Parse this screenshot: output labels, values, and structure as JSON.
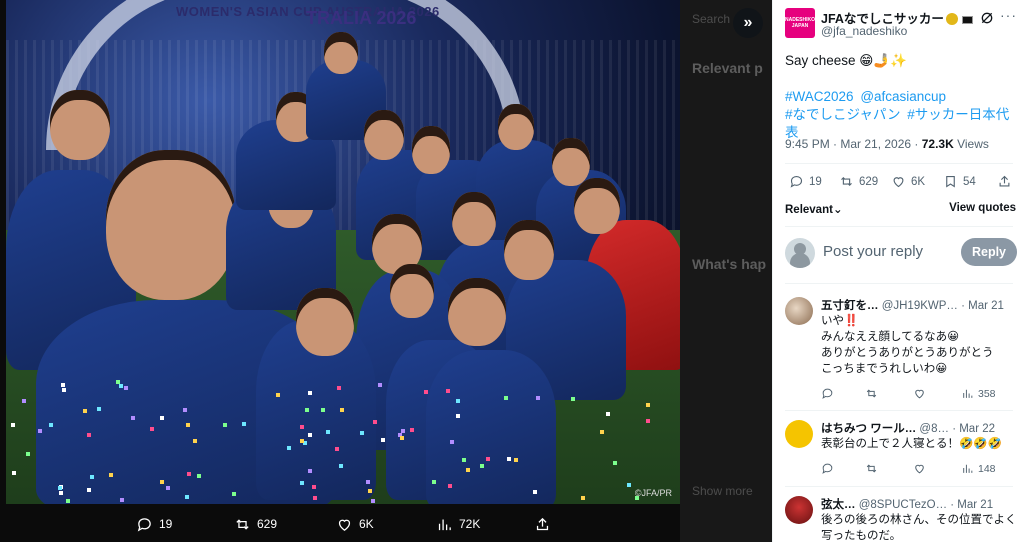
{
  "viewer": {
    "photo_alt": "",
    "arch_text_small": "WOMEN'S ASIAN CUP AUSTRALIA 2026",
    "arch_text_large": "TRALIA 2026",
    "watermark": "©JFA/PR",
    "close_icon": "chevrons-right-icon",
    "actions": {
      "replies": "19",
      "reposts": "629",
      "likes": "6K",
      "views": "72K"
    }
  },
  "background_ghost": {
    "search": "Search",
    "relevant": "Relevant p",
    "whats": "What's hap",
    "show_more": "Show more"
  },
  "post": {
    "author_name": "JFAなでしこサッカー",
    "handle": "@jfa_nadeshiko",
    "logo_text": "NADESHIKO JAPAN",
    "text": "Say cheese 😁🤳✨",
    "hashtags": [
      "#WAC2026",
      "@afcasianc up",
      "#なでしこジャパン",
      "#サッカー日本代表"
    ],
    "time": "9:45 PM · Mar 21, 2026 · ",
    "views_count": "72.3K",
    "views_label": " Views",
    "stats": {
      "replies": "19",
      "reposts": "629",
      "likes": "6K",
      "bookmarks": "54"
    },
    "relevant_label": "Relevant",
    "view_quotes_label": "View quotes"
  },
  "reply_box": {
    "placeholder": "Post your reply",
    "button": "Reply"
  },
  "replies": [
    {
      "name": "五寸釘を…",
      "handle": "@JH19KWP…",
      "date": "· Mar 21",
      "body_lines": [
        "いや‼️",
        "みんなええ顔してるなあ😀",
        "ありがとうありがとうありがとう",
        "こっちまでうれしいわ😀"
      ],
      "likes": "",
      "views": "358"
    },
    {
      "name": "はちみつ ワール…",
      "handle": "@8…",
      "date": "· Mar 22",
      "body_lines": [
        "表彰台の上で２人寝とる！🤣🤣🤣"
      ],
      "likes": "",
      "views": "148"
    },
    {
      "name": "弦太…",
      "handle": "@8SPUCTezO…",
      "date": "· Mar 21",
      "body_lines": [
        "後ろの後ろの林さん、その位置でよく写ったものだ。"
      ],
      "likes": "",
      "views": ""
    }
  ],
  "colors": {
    "accent": "#1d9bf0",
    "brand": "#e6007e",
    "reply_button": "#8b98a5",
    "kit_blue": "#1f3f8f"
  }
}
